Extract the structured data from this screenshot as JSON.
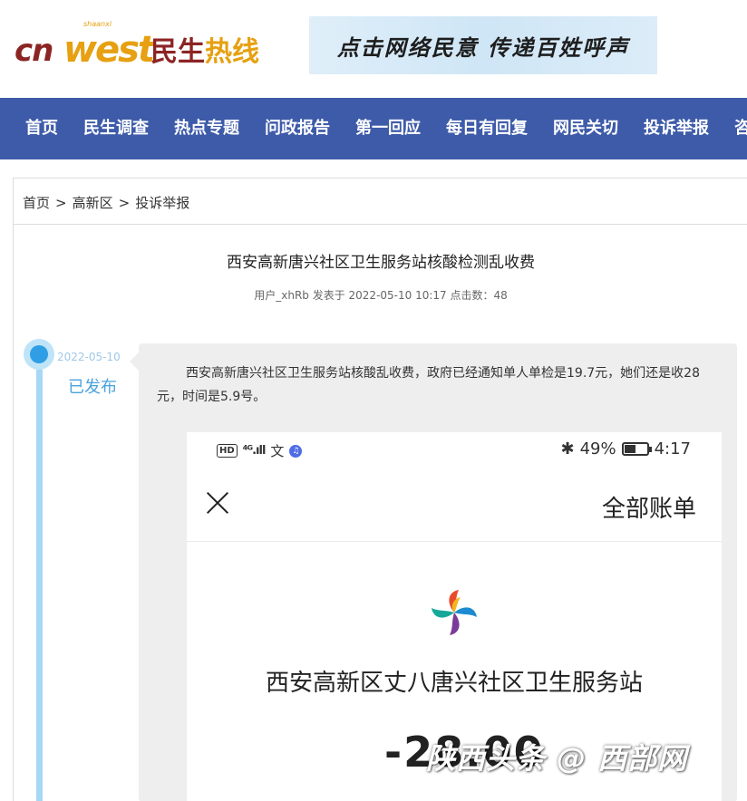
{
  "header": {
    "logo_cn": "cn",
    "logo_west": "west",
    "logo_shaanxi": "shaanxi",
    "logo_name_a": "民生",
    "logo_name_b": "热线",
    "banner_text": "点击网络民意  传递百姓呼声"
  },
  "nav": {
    "items": [
      "首页",
      "民生调查",
      "热点专题",
      "问政报告",
      "第一回应",
      "每日有回复",
      "网民关切",
      "投诉举报",
      "咨"
    ]
  },
  "breadcrumb": {
    "home": "首页",
    "district": "高新区",
    "category": "投诉举报",
    "separator": ">"
  },
  "article": {
    "title": "西安高新唐兴社区卫生服务站核酸检测乱收费",
    "meta": "用户_xhRb 发表于 2022-05-10 10:17 点击数：48"
  },
  "timeline": {
    "date": "2022-05-10",
    "status": "已发布"
  },
  "post": {
    "body": "西安高新唐兴社区卫生服务站核酸乱收费，政府已经通知单人单检是19.7元，她们还是收28元，时间是5.9号。"
  },
  "screenshot": {
    "hd": "HD",
    "signal": "⁴ᴳ.ıll",
    "wen": "文",
    "music": "♫",
    "bluetooth": "✱",
    "battery_pct": "49%",
    "time": "4:17",
    "heading": "全部账单",
    "merchant": "西安高新区丈八唐兴社区卫生服务站",
    "amount": "-28.00"
  },
  "watermark": "陕西头条 @ 西部网",
  "colors": {
    "nav_bg": "#3e5ba9",
    "logo_red": "#8c2424",
    "logo_gold": "#e6a011",
    "timeline_blue": "#2f9ee5"
  }
}
